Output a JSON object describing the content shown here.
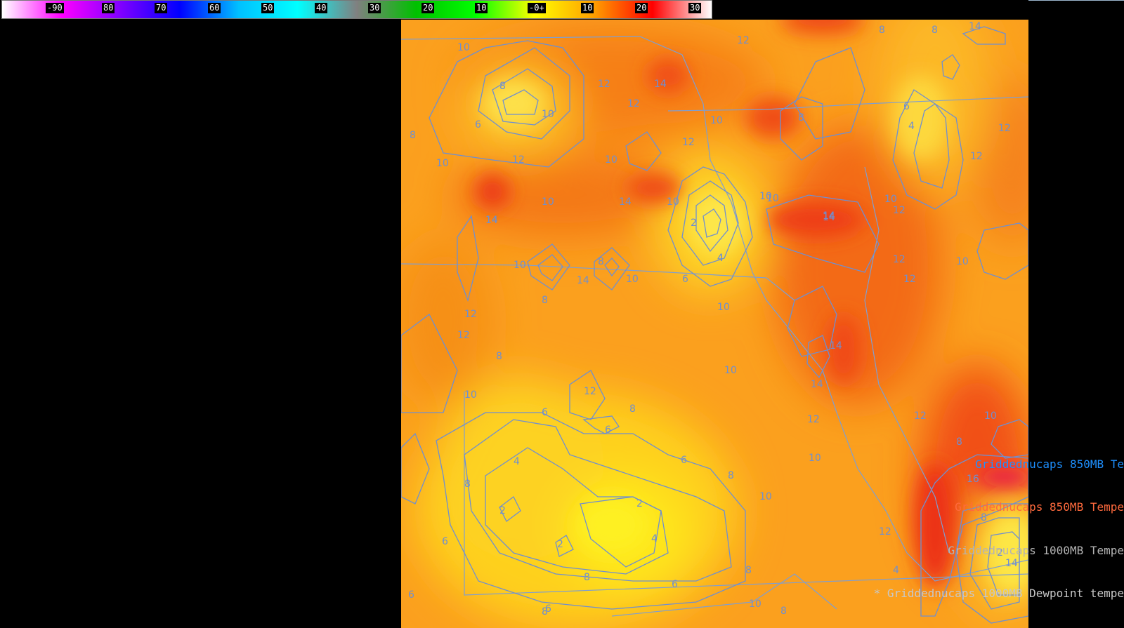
{
  "colorbar": {
    "ticks": [
      "-90",
      "80",
      "70",
      "60",
      "50",
      "40",
      "30",
      "20",
      "10",
      "-0+",
      "10",
      "20",
      "30"
    ],
    "colors": [
      "#ffffff",
      "#ff00ff",
      "#8000ff",
      "#0000ff",
      "#00c0ff",
      "#00ffff",
      "#808080",
      "#00c000",
      "#00ff00",
      "#ffff00",
      "#ffa000",
      "#ff0000",
      "#ffffff"
    ]
  },
  "map": {
    "contour_labels": [
      {
        "text": "10"
      },
      {
        "text": "12"
      },
      {
        "text": "8"
      },
      {
        "text": "8"
      },
      {
        "text": "14"
      },
      {
        "text": "8"
      },
      {
        "text": "6"
      },
      {
        "text": "10"
      },
      {
        "text": "12"
      },
      {
        "text": "14"
      },
      {
        "text": "10"
      },
      {
        "text": "8"
      },
      {
        "text": "6"
      },
      {
        "text": "4"
      },
      {
        "text": "12"
      },
      {
        "text": "12"
      },
      {
        "text": "10"
      },
      {
        "text": "12"
      },
      {
        "text": "14"
      },
      {
        "text": "10"
      },
      {
        "text": "12"
      },
      {
        "text": "14"
      },
      {
        "text": "14"
      },
      {
        "text": "10"
      },
      {
        "text": "4"
      },
      {
        "text": "10"
      },
      {
        "text": "14"
      },
      {
        "text": "10"
      },
      {
        "text": "14"
      },
      {
        "text": "2"
      },
      {
        "text": "8"
      },
      {
        "text": "4"
      },
      {
        "text": "6"
      },
      {
        "text": "14"
      },
      {
        "text": "12"
      },
      {
        "text": "10"
      },
      {
        "text": "10"
      },
      {
        "text": "8"
      },
      {
        "text": "12"
      },
      {
        "text": "8"
      },
      {
        "text": "10"
      },
      {
        "text": "12"
      },
      {
        "text": "10"
      },
      {
        "text": "10"
      },
      {
        "text": "12"
      },
      {
        "text": "12"
      },
      {
        "text": "10"
      },
      {
        "text": "14"
      },
      {
        "text": "12"
      },
      {
        "text": "8"
      },
      {
        "text": "10"
      },
      {
        "text": "14"
      },
      {
        "text": "12"
      },
      {
        "text": "10"
      },
      {
        "text": "6"
      },
      {
        "text": "8"
      },
      {
        "text": "6"
      },
      {
        "text": "12"
      },
      {
        "text": "12"
      },
      {
        "text": "10"
      },
      {
        "text": "10"
      },
      {
        "text": "8"
      },
      {
        "text": "4"
      },
      {
        "text": "6"
      },
      {
        "text": "8"
      },
      {
        "text": "16"
      },
      {
        "text": "8"
      },
      {
        "text": "2"
      },
      {
        "text": "2"
      },
      {
        "text": "2"
      },
      {
        "text": "4"
      },
      {
        "text": "10"
      },
      {
        "text": "12"
      },
      {
        "text": "8"
      },
      {
        "text": "6"
      },
      {
        "text": "14"
      },
      {
        "text": "4"
      },
      {
        "text": "6"
      },
      {
        "text": "8"
      },
      {
        "text": "8"
      },
      {
        "text": "8"
      },
      {
        "text": "6"
      },
      {
        "text": "8"
      },
      {
        "text": "10"
      },
      {
        "text": "2"
      },
      {
        "text": "6"
      }
    ]
  },
  "legend": {
    "line1": "Griddednucaps 850MB Te",
    "line2": "Griddednucaps 850MB Tempe",
    "line3": "Griddednucaps 1000MB Tempe",
    "line4": "* Griddednucaps 1000MB Dewpoint tempe",
    "colors": {
      "line1": "#1e90ff",
      "line2": "#ff6a3d",
      "line3": "#b4b4b4",
      "line4": "#c8c8c8"
    }
  }
}
